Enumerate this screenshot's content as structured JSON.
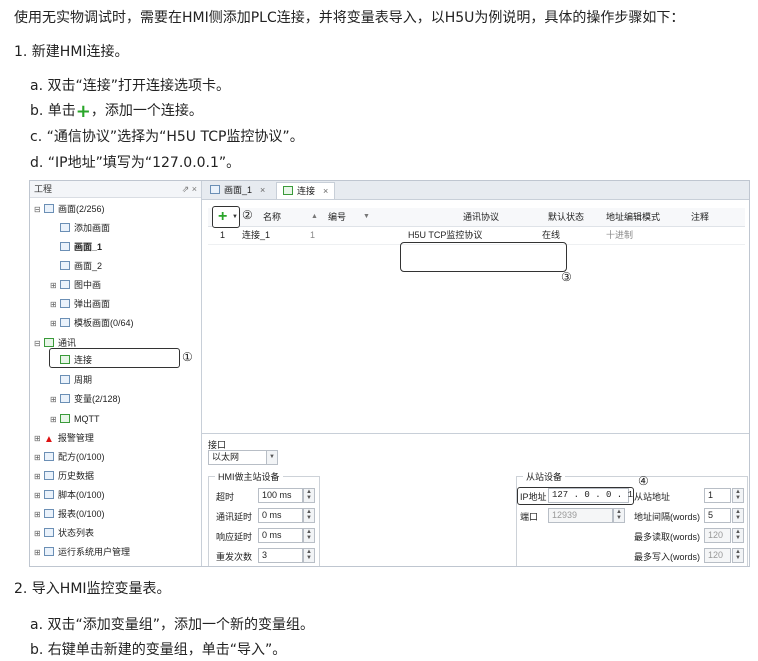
{
  "intro": "使用无实物调试时，需要在HMI侧添加PLC连接，并将变量表导入，以H5U为例说明，具体的操作步骤如下：",
  "step1": {
    "title": "1. 新建HMI连接。",
    "a": "a. 双击“连接”打开连接选项卡。",
    "b_before": "b. 单击",
    "b_plus": "+",
    "b_after": "，添加一个连接。",
    "c": "c. “通信协议”选择为“H5U TCP监控协议”。",
    "d": "d. “IP地址”填写为“127.0.0.1”。"
  },
  "screenshot": {
    "tree": {
      "title": "工程",
      "ctrls": "⇗ ×",
      "items": [
        {
          "label": "画面(2/256)",
          "exp": "⊟"
        },
        {
          "label": "添加画面",
          "exp": ""
        },
        {
          "label": "画面_1",
          "exp": ""
        },
        {
          "label": "画面_2",
          "exp": ""
        },
        {
          "label": "图中画",
          "exp": "⊞"
        },
        {
          "label": "弹出画面",
          "exp": "⊞"
        },
        {
          "label": "模板画面(0/64)",
          "exp": "⊞"
        },
        {
          "label": "通讯",
          "exp": "⊟"
        },
        {
          "label": "连接",
          "exp": ""
        },
        {
          "label": "周期",
          "exp": ""
        },
        {
          "label": "变量(2/128)",
          "exp": "⊞"
        },
        {
          "label": "MQTT",
          "exp": "⊞"
        },
        {
          "label": "报警管理",
          "exp": "⊞"
        },
        {
          "label": "配方(0/100)",
          "exp": "⊞"
        },
        {
          "label": "历史数据",
          "exp": "⊞"
        },
        {
          "label": "脚本(0/100)",
          "exp": "⊞"
        },
        {
          "label": "报表(0/100)",
          "exp": "⊞"
        },
        {
          "label": "状态列表",
          "exp": "⊞"
        },
        {
          "label": "运行系统用户管理",
          "exp": "⊞"
        }
      ],
      "marker": "①"
    },
    "tabs": [
      {
        "label": "画面_1",
        "close": "×"
      },
      {
        "label": "连接",
        "close": "×"
      }
    ],
    "grid": {
      "headers": [
        "名称",
        "编号",
        "通讯协议",
        "默认状态",
        "地址编辑模式",
        "注释"
      ],
      "sort_up": "▲",
      "sort_down": "▼",
      "row": {
        "index": "1",
        "name": "连接_1",
        "number": "1",
        "protocol": "H5U TCP监控协议",
        "status": "在线",
        "addr_mode": "十进制",
        "note": ""
      },
      "marker_add": "②",
      "marker_proto": "③"
    },
    "props": {
      "iface_label": "接口",
      "iface_value": "以太网",
      "master_group": "HMI做主站设备",
      "timeout_label": "超时",
      "timeout_value": "100 ms",
      "comm_delay_label": "通讯延时",
      "comm_delay_value": "0 ms",
      "resp_delay_label": "响应延时",
      "resp_delay_value": "0 ms",
      "resend_label": "重发次数",
      "resend_value": "3",
      "slave_group": "从站设备",
      "ip_label": "IP地址",
      "ip_value": "127 . 0 . 0 . 1",
      "slave_addr_label": "从站地址",
      "slave_addr_value": "1",
      "port_label": "端口",
      "port_value": "12939",
      "addr_interval_label": "地址间隔(words)",
      "addr_interval_value": "5",
      "max_read_label": "最多读取(words)",
      "max_read_value": "120",
      "max_write_label": "最多写入(words)",
      "max_write_value": "120",
      "marker_ip": "④"
    }
  },
  "step2": {
    "title": "2. 导入HMI监控变量表。",
    "a": "a. 双击“添加变量组”，添加一个新的变量组。",
    "b": "b. 右键单击新建的变量组，单击“导入”。"
  }
}
